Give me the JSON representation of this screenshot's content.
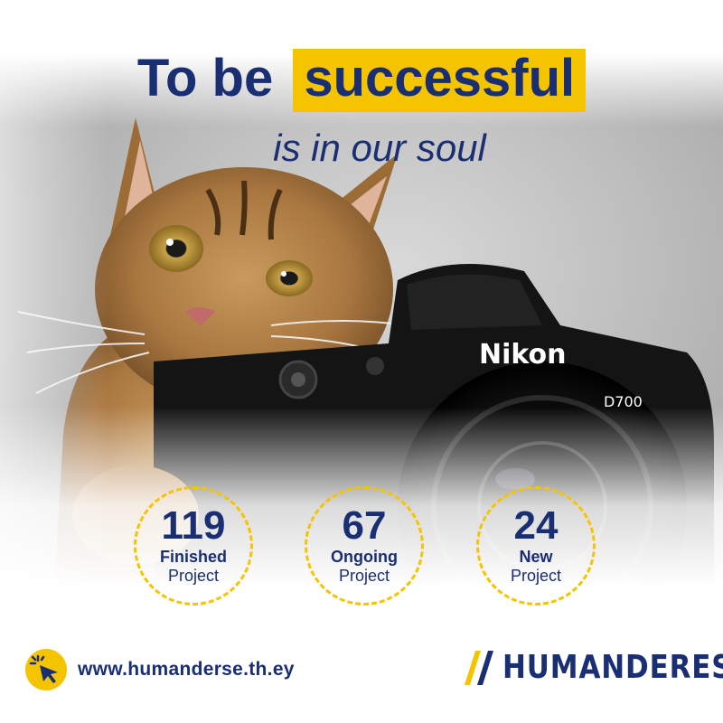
{
  "headline": {
    "prefix": "To be",
    "highlight": "successful",
    "sub": "is in our soul"
  },
  "camera": {
    "brand": "Nikon",
    "model": "D700"
  },
  "stats": [
    {
      "number": "119",
      "line1": "Finished",
      "line2": "Project"
    },
    {
      "number": "67",
      "line1": "Ongoing",
      "line2": "Project"
    },
    {
      "number": "24",
      "line1": "New",
      "line2": "Project"
    }
  ],
  "footer": {
    "url": "www.humanderse.th.ey",
    "url_icon": "cursor-click-icon",
    "brand": "HUMANDERES",
    "brand_icon": "double-slash-logo-icon"
  },
  "colors": {
    "navy": "#1a2f73",
    "yellow": "#f5c400"
  }
}
